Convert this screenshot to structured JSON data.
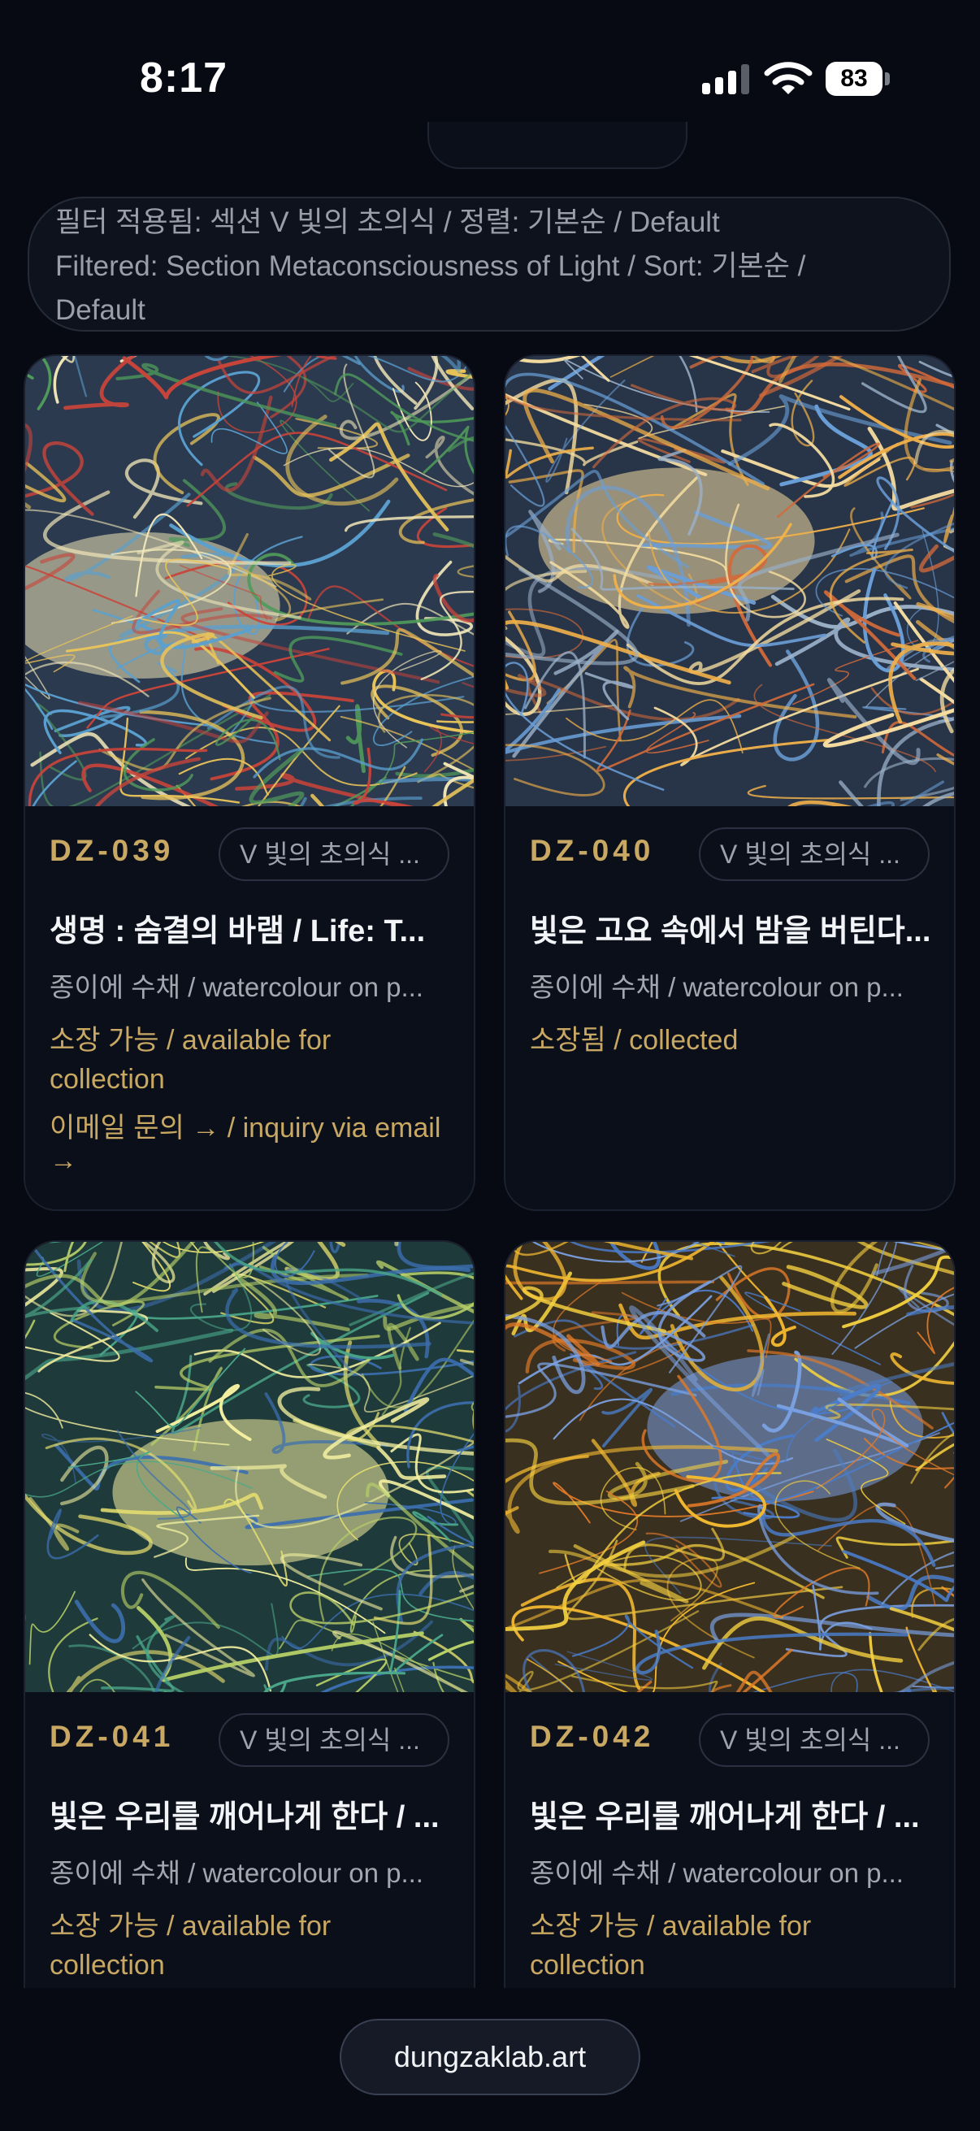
{
  "status_bar": {
    "time": "8:17",
    "battery": "83"
  },
  "filter": {
    "line1": "필터 적용됨: 섹션 V 빛의 초의식 / 정렬: 기본순 / Default",
    "line2": "Filtered: Section Metaconsciousness of Light / Sort: 기본순 /",
    "line3": "Default"
  },
  "cards": [
    {
      "code": "DZ-039",
      "section": "V 빛의 초의식 ...",
      "title": "생명 : 숨결의 바램 / Life: T...",
      "medium": "종이에 수채 / watercolour on p...",
      "status_line1": "소장 가능 / available for",
      "status_line2": "collection",
      "inquiry_line1": "이메일 문의 → / inquiry via email",
      "inquiry_line2": "→",
      "palette": [
        "#2c3a4f",
        "#e8c35a",
        "#5aa0d0",
        "#c9443a",
        "#4f9a5a",
        "#f0e6b8"
      ]
    },
    {
      "code": "DZ-040",
      "section": "V 빛의 초의식 ...",
      "title": "빛은 고요 속에서 밤을 버틴다...",
      "medium": "종이에 수채 / watercolour on p...",
      "status_line1": "소장됨 / collected",
      "palette": [
        "#283447",
        "#f0b04a",
        "#6a9fd8",
        "#d36a3a",
        "#9ab0c8",
        "#f4dca0"
      ]
    },
    {
      "code": "DZ-041",
      "section": "V 빛의 초의식 ...",
      "title": "빛은 우리를 깨어나게 한다 / ...",
      "medium": "종이에 수채 / watercolour on p...",
      "status_line1": "소장 가능 / available for",
      "status_line2": "collection",
      "palette": [
        "#1f3a3a",
        "#e8e070",
        "#4aa88a",
        "#3c6fb0",
        "#b8d068",
        "#f4f0a0"
      ]
    },
    {
      "code": "DZ-042",
      "section": "V 빛의 초의식 ...",
      "title": "빛은 우리를 깨어나게 한다 / ...",
      "medium": "종이에 수채 / watercolour on p...",
      "status_line1": "소장 가능 / available for",
      "status_line2": "collection",
      "palette": [
        "#3a3020",
        "#f2b830",
        "#4a7cc8",
        "#e07a28",
        "#f4d040",
        "#7aa0e0"
      ]
    }
  ],
  "footer": {
    "domain": "dungzaklab.art"
  }
}
